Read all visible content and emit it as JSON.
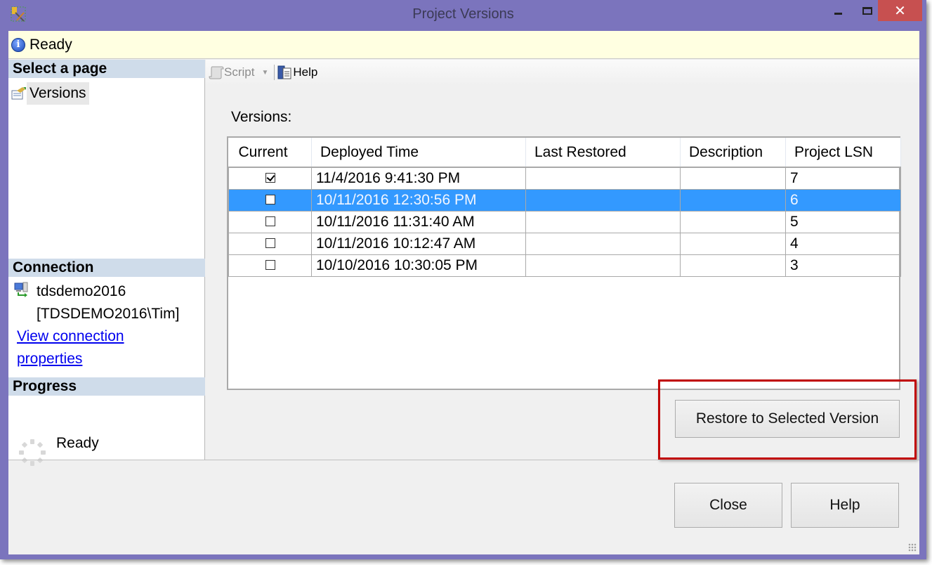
{
  "window": {
    "title": "Project Versions",
    "frame_color": "#7b74bd",
    "close_color": "#c75050"
  },
  "infobar": {
    "icon": "info-icon",
    "icon_glyph": "i",
    "status": "Ready"
  },
  "sidebar": {
    "select_page_header": "Select a page",
    "pages": [
      {
        "label": "Versions",
        "icon": "properties-page-icon",
        "selected": true
      }
    ],
    "connection_header": "Connection",
    "connection": {
      "server": "tdsdemo2016",
      "user": "[TDSDEMO2016\\Tim]",
      "link": "View connection properties"
    },
    "progress_header": "Progress",
    "progress_status": "Ready"
  },
  "toolbar": {
    "script_label": "Script",
    "help_label": "Help"
  },
  "main": {
    "versions_label": "Versions:",
    "columns": [
      "Current",
      "Deployed Time",
      "Last Restored",
      "Description",
      "Project LSN"
    ],
    "rows": [
      {
        "current": true,
        "deployed_time": "11/4/2016 9:41:30 PM",
        "last_restored": "",
        "description": "",
        "project_lsn": "7",
        "selected": false
      },
      {
        "current": false,
        "deployed_time": "10/11/2016 12:30:56 PM",
        "last_restored": "",
        "description": "",
        "project_lsn": "6",
        "selected": true
      },
      {
        "current": false,
        "deployed_time": "10/11/2016 11:31:40 AM",
        "last_restored": "",
        "description": "",
        "project_lsn": "5",
        "selected": false
      },
      {
        "current": false,
        "deployed_time": "10/11/2016 10:12:47 AM",
        "last_restored": "",
        "description": "",
        "project_lsn": "4",
        "selected": false
      },
      {
        "current": false,
        "deployed_time": "10/10/2016 10:30:05 PM",
        "last_restored": "",
        "description": "",
        "project_lsn": "3",
        "selected": false
      }
    ],
    "selection_color": "#3399ff",
    "restore_button": "Restore to Selected Version",
    "highlight_color": "#c00000"
  },
  "footer": {
    "close_button": "Close",
    "help_button": "Help"
  }
}
